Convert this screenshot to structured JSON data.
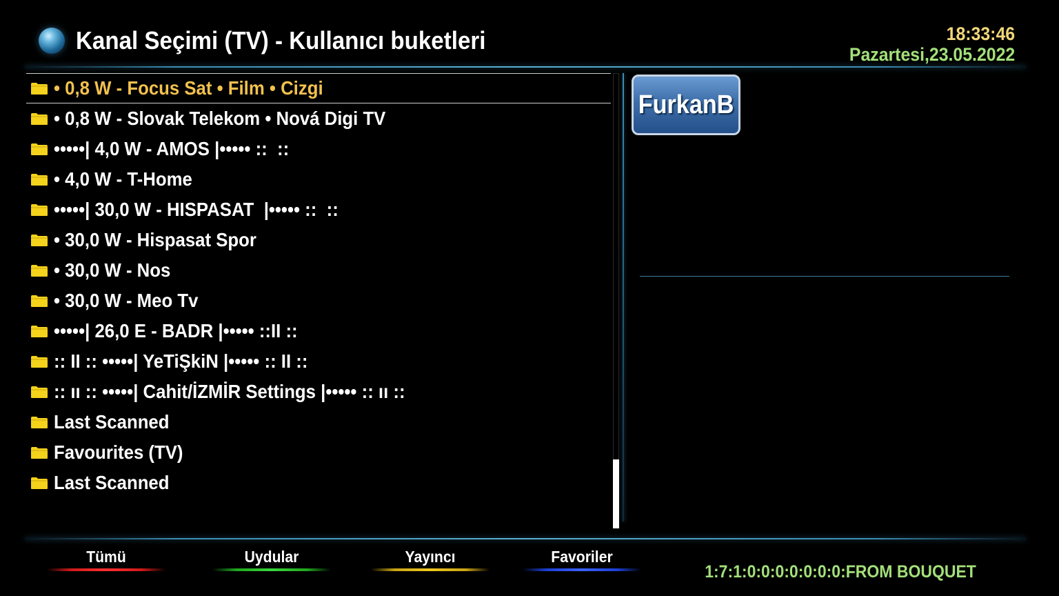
{
  "header": {
    "title": "Kanal Seçimi (TV) - Kullanıcı buketleri",
    "time": "18:33:46",
    "date": "Pazartesi,23.05.2022"
  },
  "bouquets": [
    {
      "label": "• 0,8 W - Focus Sat • Film • Cizgi",
      "selected": true
    },
    {
      "label": "• 0,8 W - Slovak Telekom • Nová Digi TV"
    },
    {
      "label": "•••••| 4,0 W - AMOS |••••• ::  ::"
    },
    {
      "label": "• 4,0 W - T-Home"
    },
    {
      "label": "•••••| 30,0 W - HISPASAT  |••••• ::  ::"
    },
    {
      "label": "• 30,0 W - Hispasat Spor"
    },
    {
      "label": "• 30,0 W - Nos"
    },
    {
      "label": "• 30,0 W - Meo Tv"
    },
    {
      "label": "•••••| 26,0 E - BADR |••••• ::II ::"
    },
    {
      "label": ":: II :: •••••| YeTiŞkiN |••••• :: II ::"
    },
    {
      "label": ":: ıı :: •••••| Cahit/İZMİR Settings |••••• :: ıı ::"
    },
    {
      "label": "Last Scanned"
    },
    {
      "label": "Favourites (TV)"
    },
    {
      "label": "Last Scanned"
    }
  ],
  "picon": {
    "text": "FurkanB"
  },
  "buttons": {
    "red": "Tümü",
    "green": "Uydular",
    "yellow": "Yayıncı",
    "blue": "Favoriler"
  },
  "service_ref": "1:7:1:0:0:0:0:0:0:0:FROM BOUQUET",
  "colors": {
    "selected_text": "#f2c14e",
    "clock": "#f2d77a",
    "date": "#a4e07a",
    "folder": "#f5d21b",
    "red": "#d01818",
    "green": "#1fa51f",
    "yellow": "#c9a414",
    "blue": "#1b3fd6"
  }
}
